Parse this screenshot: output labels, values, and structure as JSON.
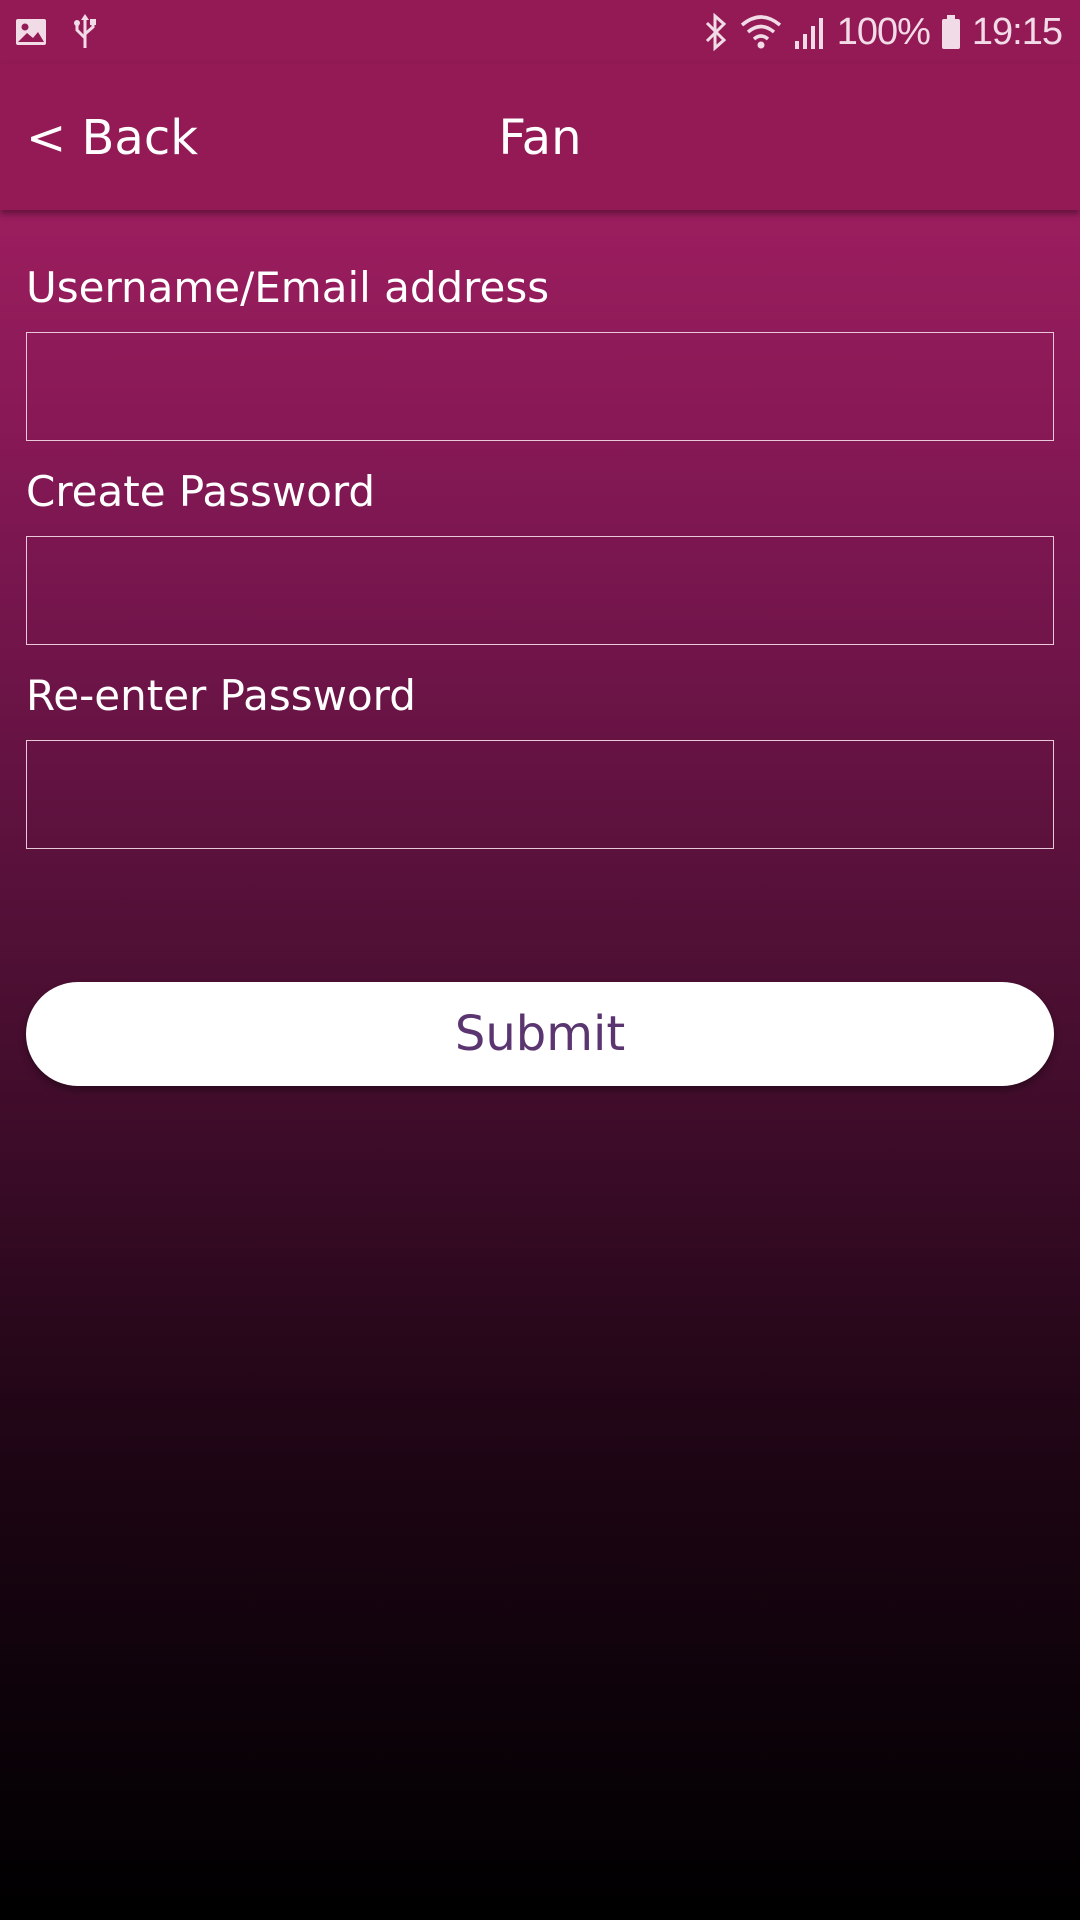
{
  "status_bar": {
    "left_icons": [
      "gallery-icon",
      "usb-icon"
    ],
    "right_icons": [
      "bluetooth-icon",
      "wifi-icon",
      "signal-icon",
      "battery-icon"
    ],
    "battery": "100%",
    "time": "19:15"
  },
  "header": {
    "back_label": "< Back",
    "title": "Fan"
  },
  "form": {
    "username_label": "Username/Email address",
    "username_value": "",
    "password_label": "Create Password",
    "password_value": "",
    "reenter_label": "Re-enter Password",
    "reenter_value": ""
  },
  "submit_label": "Submit",
  "colors": {
    "header_bg": "#931a55",
    "gradient_top": "#9a1d5e",
    "gradient_bottom": "#000000",
    "button_text": "#5b3570"
  }
}
